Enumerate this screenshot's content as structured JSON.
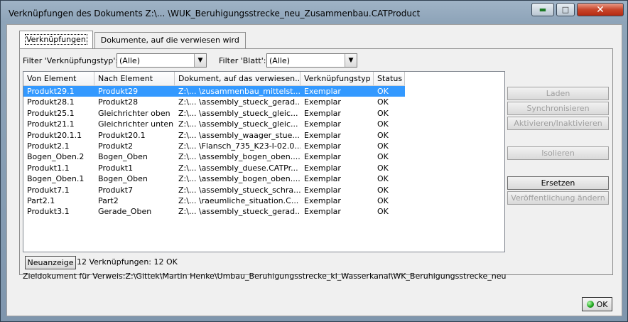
{
  "window": {
    "title": "Verknüpfungen des Dokuments Z:\\... \\WUK_Beruhigungsstrecke_neu_Zusammenbau.CATProduct",
    "buttons": {
      "minimize": "▬",
      "maximize": "□",
      "close": "✕"
    }
  },
  "tabs": [
    {
      "label": "Verknüpfungen"
    },
    {
      "label": "Dokumente, auf die verwiesen wird"
    }
  ],
  "filters": {
    "type_label": "Filter 'Verknüpfungstyp':",
    "type_value": "(Alle)",
    "sheet_label": "Filter 'Blatt':",
    "sheet_value": "(Alle)"
  },
  "table": {
    "columns": [
      "Von Element",
      "Nach Element",
      "Dokument, auf das verwiesen...",
      "Verknüpfungstyp",
      "Status"
    ],
    "rows": [
      [
        "Produkt29.1",
        "Produkt29",
        "Z:\\... \\zusammenbau_mittelst...",
        "Exemplar",
        "OK"
      ],
      [
        "Produkt28.1",
        "Produkt28",
        "Z:\\... \\assembly_stueck_gerad...",
        "Exemplar",
        "OK"
      ],
      [
        "Produkt25.1",
        "Gleichrichter oben",
        "Z:\\... \\assembly_stueck_gleic...",
        "Exemplar",
        "OK"
      ],
      [
        "Produkt21.1",
        "Gleichrichter unten",
        "Z:\\... \\assembly_stueck_gleic...",
        "Exemplar",
        "OK"
      ],
      [
        "Produkt20.1.1",
        "Produkt20.1",
        "Z:\\... \\assembly_waager_stue...",
        "Exemplar",
        "OK"
      ],
      [
        "Produkt2.1",
        "Produkt2",
        "Z:\\... \\Flansch_735_K23-I-02.0...",
        "Exemplar",
        "OK"
      ],
      [
        "Bogen_Oben.2",
        "Bogen_Oben",
        "Z:\\... \\assembly_bogen_oben....",
        "Exemplar",
        "OK"
      ],
      [
        "Produkt1.1",
        "Produkt1",
        "Z:\\... \\assembly_duese.CATPr...",
        "Exemplar",
        "OK"
      ],
      [
        "Bogen_Oben.1",
        "Bogen_Oben",
        "Z:\\... \\assembly_bogen_oben....",
        "Exemplar",
        "OK"
      ],
      [
        "Produkt7.1",
        "Produkt7",
        "Z:\\... \\assembly_stueck_schra...",
        "Exemplar",
        "OK"
      ],
      [
        "Part2.1",
        "Part2",
        "Z:\\... \\raeumliche_situation.C...",
        "Exemplar",
        "OK"
      ],
      [
        "Produkt3.1",
        "Gerade_Oben",
        "Z:\\... \\assembly_stueck_gerad...",
        "Exemplar",
        "OK"
      ]
    ]
  },
  "actions": {
    "load": "Laden",
    "sync": "Synchronisieren",
    "activate": "Aktivieren/Inaktivieren",
    "isolate": "Isolieren",
    "replace": "Ersetzen",
    "publish": "Veröffentlichung ändern"
  },
  "footer": {
    "refresh": "Neuanzeige",
    "summary": "12 Verknüpfungen: 12 OK",
    "target": "Zieldokument für Verweis:Z:\\Gittek\\Martin Henke\\Umbau_Beruhigungsstrecke_kl_Wasserkanal\\WK_Beruhigungsstrecke_neu\\Teile",
    "ok": "OK"
  }
}
